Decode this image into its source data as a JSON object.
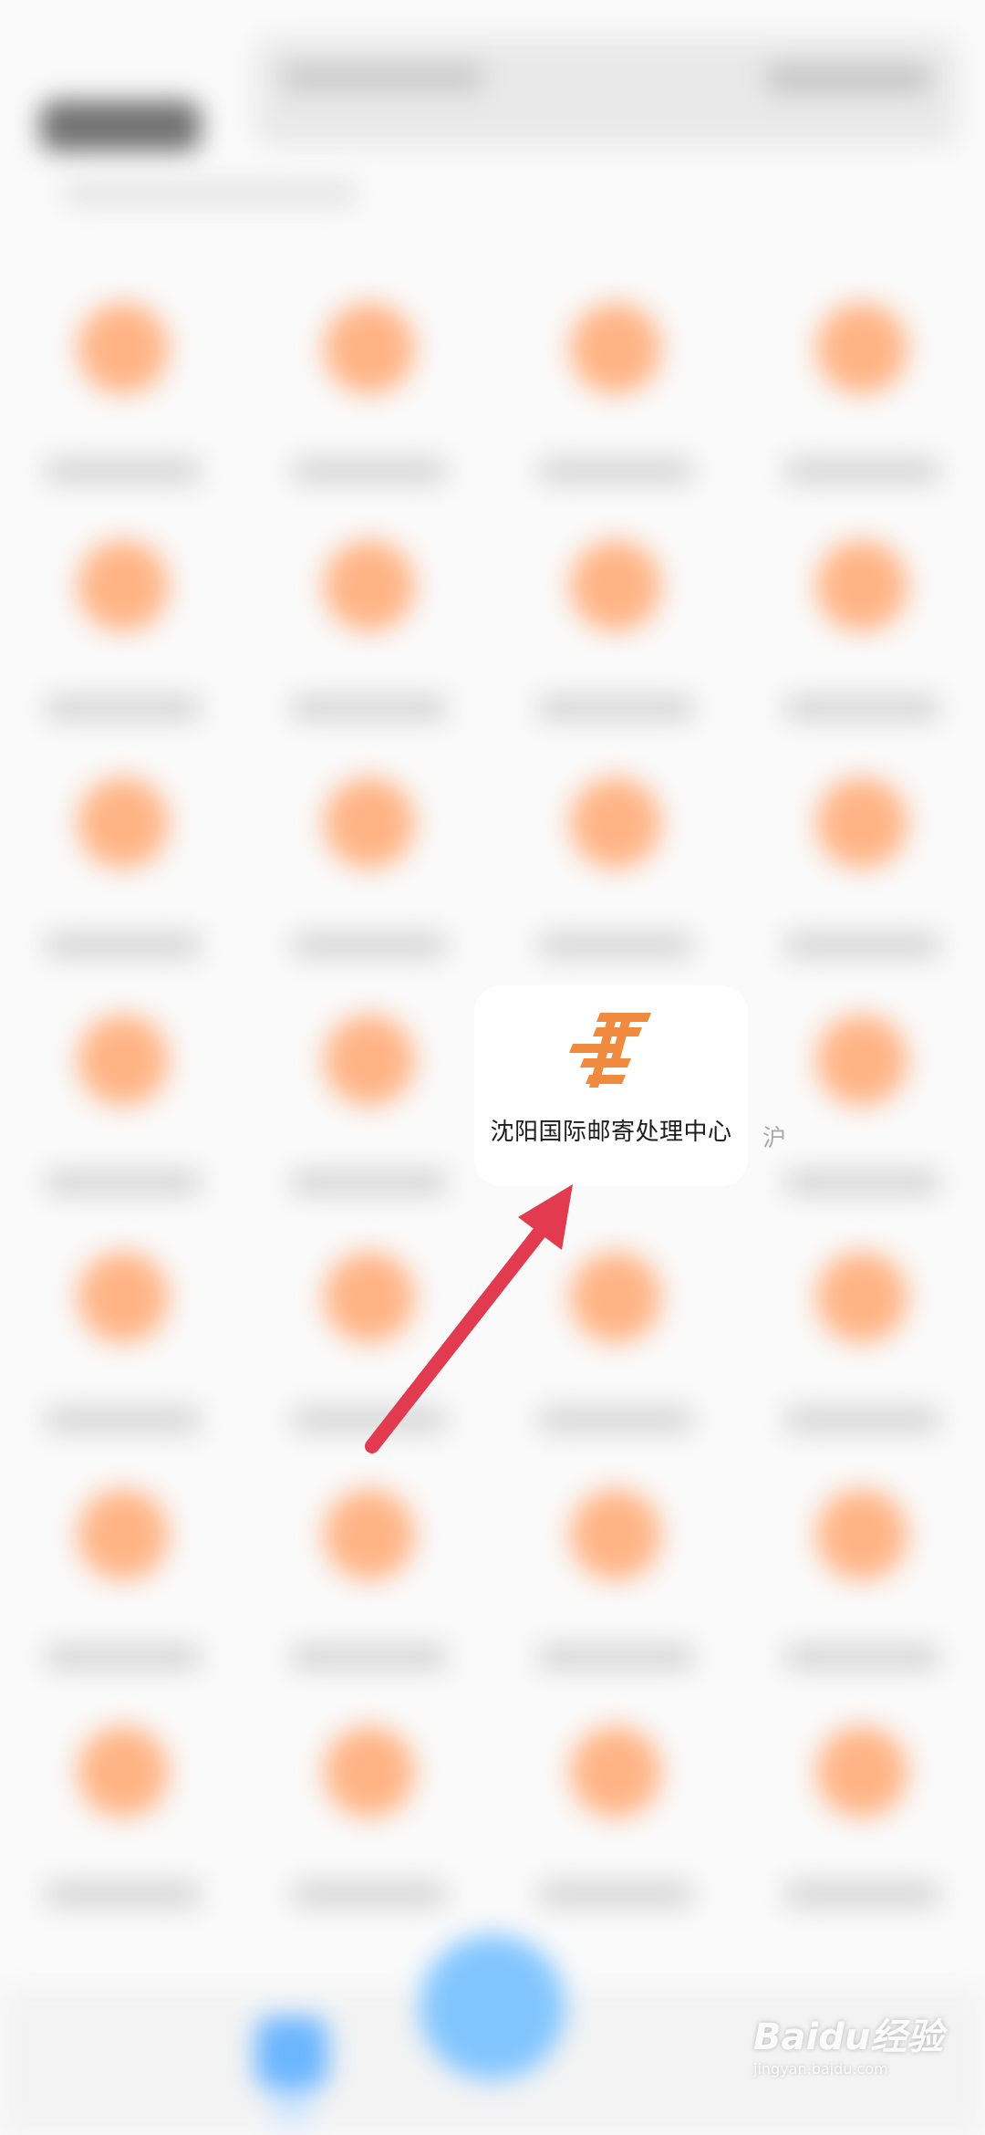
{
  "header": {
    "tab_label": "",
    "card_title": ""
  },
  "focused_item": {
    "label": "沈阳国际邮寄处理中心",
    "icon": "china-post-icon",
    "icon_color": "#f08a3e"
  },
  "side_fragment": "沪",
  "watermark": {
    "brand": "Baidu经验",
    "url": "jingyan.baidu.com"
  },
  "colors": {
    "accent_orange": "#ffb485",
    "arrow_red": "#e23a4e",
    "nav_blue": "#82c6ff"
  }
}
